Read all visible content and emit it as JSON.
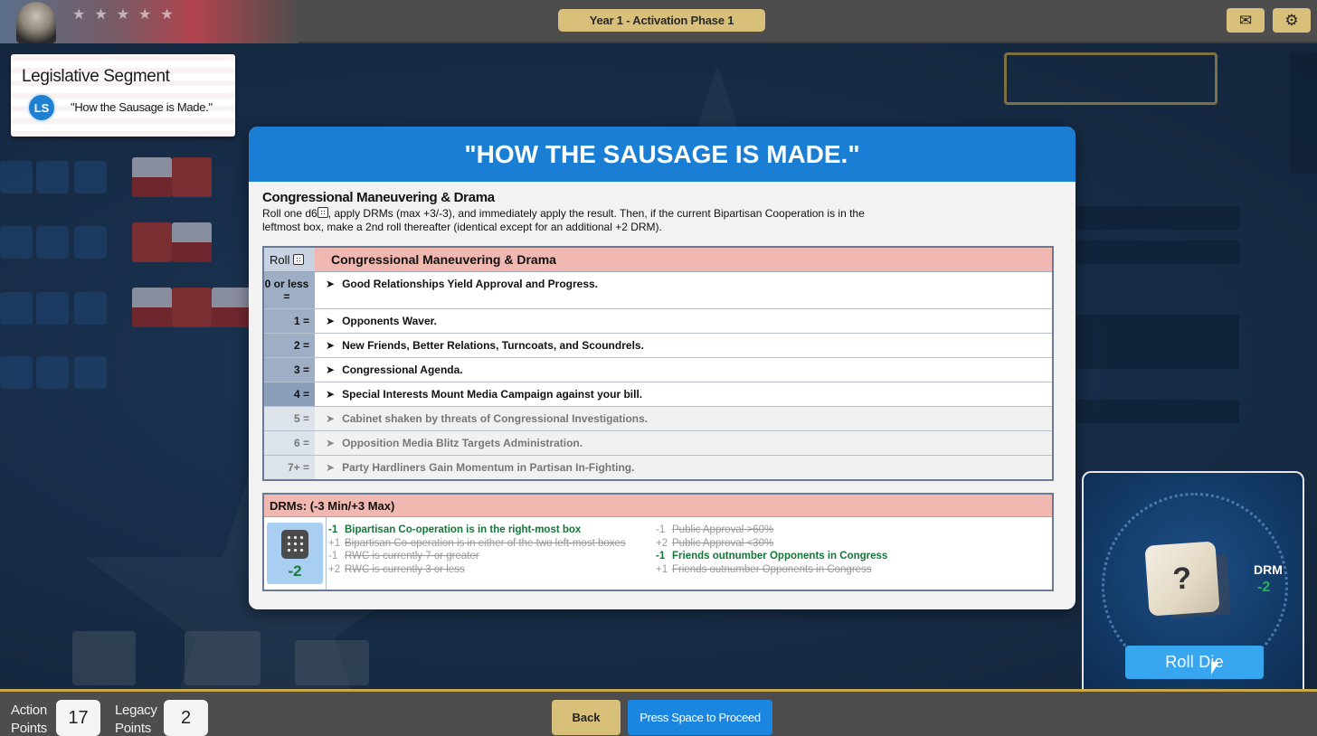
{
  "topbar": {
    "phase": "Year 1  -  Activation Phase 1",
    "mail_icon": "envelope-icon",
    "settings_icon": "gear-icon"
  },
  "segment_card": {
    "title": "Legislative Segment",
    "badge": "LS",
    "subtitle": "\"How the Sausage is Made.\""
  },
  "modal": {
    "title": "\"HOW THE SAUSAGE IS MADE.\"",
    "rule_title": "Congressional Maneuvering & Drama",
    "rule_text_before_die": "Roll one d6",
    "rule_text_after_die": ", apply DRMs (max +3/-3), and immediately apply the result. Then, if the current Bipartisan Cooperation is in the leftmost box, make a 2nd roll thereafter (identical except for an additional +2 DRM).",
    "table": {
      "roll_header": "Roll",
      "header": "Congressional Maneuvering & Drama",
      "rows": [
        {
          "roll": "0 or less =",
          "text": "Good Relationships Yield Approval and Progress.",
          "active": true
        },
        {
          "roll": "1 =",
          "text": "Opponents Waver.",
          "active": true
        },
        {
          "roll": "2 =",
          "text": "New Friends, Better Relations, Turncoats, and Scoundrels.",
          "active": true
        },
        {
          "roll": "3 =",
          "text": "Congressional Agenda.",
          "active": true
        },
        {
          "roll": "4 =",
          "text": "Special Interests Mount Media Campaign against your bill.",
          "active": true
        },
        {
          "roll": "5 =",
          "text": "Cabinet shaken by threats of Congressional Investigations.",
          "active": false
        },
        {
          "roll": "6 =",
          "text": "Opposition Media Blitz Targets Administration.",
          "active": false
        },
        {
          "roll": "7+ =",
          "text": "Party Hardliners Gain Momentum in Partisan In-Fighting.",
          "active": false
        }
      ]
    },
    "drm": {
      "header": "DRMs: (-3 Min/+3 Max)",
      "total": "-2",
      "left": [
        {
          "mod": "-1",
          "text": "Bipartisan Co-operation is in the right-most box",
          "state": "active"
        },
        {
          "mod": "+1",
          "text": "Bipartisan Co-operation is in either of the two left-most boxes",
          "state": "struck"
        },
        {
          "mod": "-1",
          "text": "RWC is currently 7 or greater",
          "state": "struck"
        },
        {
          "mod": "+2",
          "text": "RWC is currently 3 or less",
          "state": "struck"
        }
      ],
      "right": [
        {
          "mod": "-1",
          "text": "Public Approval >60%",
          "state": "struck"
        },
        {
          "mod": "+2",
          "text": "Public Approval <30%",
          "state": "struck"
        },
        {
          "mod": "-1",
          "text": "Friends outnumber Opponents in Congress",
          "state": "active"
        },
        {
          "mod": "+1",
          "text": "Friends outnumber Opponents in Congress",
          "state": "struck"
        }
      ]
    }
  },
  "dice_panel": {
    "die_face": "?",
    "drm_label": "DRM",
    "drm_value": "-2",
    "roll_button": "Roll Die"
  },
  "bottombar": {
    "action_label_1": "Action",
    "action_label_2": "Points",
    "action_value": "17",
    "legacy_label_1": "Legacy",
    "legacy_label_2": "Points",
    "legacy_value": "2",
    "back_button": "Back",
    "proceed_button": "Press Space to Proceed"
  },
  "colors": {
    "accent_blue": "#1a7fd4",
    "gold": "#d9c07a",
    "table_header_pink": "#f0b8b1",
    "drm_active_green": "#16763a"
  }
}
